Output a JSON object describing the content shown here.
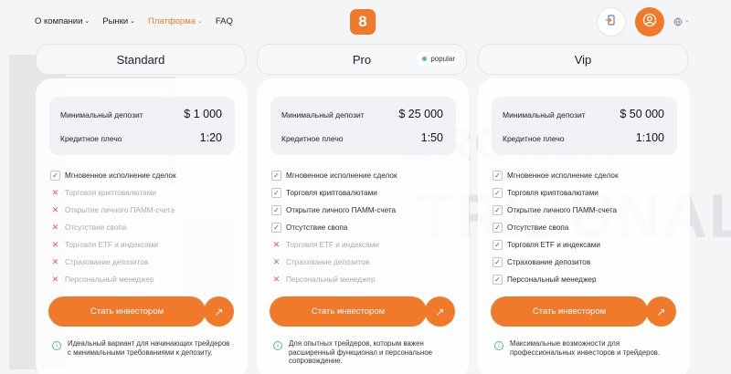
{
  "nav": {
    "items": [
      {
        "label": "О компании",
        "has_dropdown": true,
        "active": false
      },
      {
        "label": "Рынки",
        "has_dropdown": true,
        "active": false
      },
      {
        "label": "Платформа",
        "has_dropdown": true,
        "active": true
      },
      {
        "label": "FAQ",
        "has_dropdown": false,
        "active": false
      }
    ],
    "logo_glyph": "8",
    "login_icon": "login-door-icon",
    "user_icon": "user-circle-icon",
    "language_icon": "globe-icon",
    "accent_color": "#f07a2a"
  },
  "watermark": {
    "line1": "BROKER",
    "line2": "TRIBUNAL"
  },
  "plans": [
    {
      "name": "Standard",
      "badge": "",
      "deposit_label": "Минимальный депозит",
      "deposit_value": "$ 1 000",
      "leverage_label": "Кредитное плечо",
      "leverage_value": "1:20",
      "features": [
        {
          "label": "Мгновенное исполнение сделок",
          "included": true
        },
        {
          "label": "Торговля криптовалютами",
          "included": false
        },
        {
          "label": "Открытие личного ПАММ-счета",
          "included": false
        },
        {
          "label": "Отсутствие свопа",
          "included": false
        },
        {
          "label": "Торговля ETF и индексами",
          "included": false
        },
        {
          "label": "Страхование депозитов",
          "included": false
        },
        {
          "label": "Персональный менеджер",
          "included": false
        }
      ],
      "cta_label": "Стать инвестором",
      "note": "Идеальный вариант для начинающих трейдеров с минимальными требованиями к депозиту."
    },
    {
      "name": "Pro",
      "badge": "popular",
      "deposit_label": "Минимальный депозит",
      "deposit_value": "$ 25 000",
      "leverage_label": "Кредитное плечо",
      "leverage_value": "1:50",
      "features": [
        {
          "label": "Мгновенное исполнение сделок",
          "included": true
        },
        {
          "label": "Торговля криптовалютами",
          "included": true
        },
        {
          "label": "Открытие личного ПАММ-счета",
          "included": true
        },
        {
          "label": "Отсутствие свопа",
          "included": true
        },
        {
          "label": "Торговля ETF и индексами",
          "included": false
        },
        {
          "label": "Страхование депозитов",
          "included": false
        },
        {
          "label": "Персональный менеджер",
          "included": false
        }
      ],
      "cta_label": "Стать инвестором",
      "note": "Для опытных трейдеров, которым важен расширенный функционал и персональное сопровождение."
    },
    {
      "name": "Vip",
      "badge": "",
      "deposit_label": "Минимальный депозит",
      "deposit_value": "$ 50 000",
      "leverage_label": "Кредитное плечо",
      "leverage_value": "1:100",
      "features": [
        {
          "label": "Мгновенное исполнение сделок",
          "included": true
        },
        {
          "label": "Торговля криптовалютами",
          "included": true
        },
        {
          "label": "Открытие личного ПАММ-счета",
          "included": true
        },
        {
          "label": "Отсутствие свопа",
          "included": true
        },
        {
          "label": "Торговля ETF и индексами",
          "included": true
        },
        {
          "label": "Страхование депозитов",
          "included": true
        },
        {
          "label": "Персональный менеджер",
          "included": true
        }
      ],
      "cta_label": "Стать инвестором",
      "note": "Максимальные возможности для профессиональных инвесторов и трейдеров."
    }
  ]
}
